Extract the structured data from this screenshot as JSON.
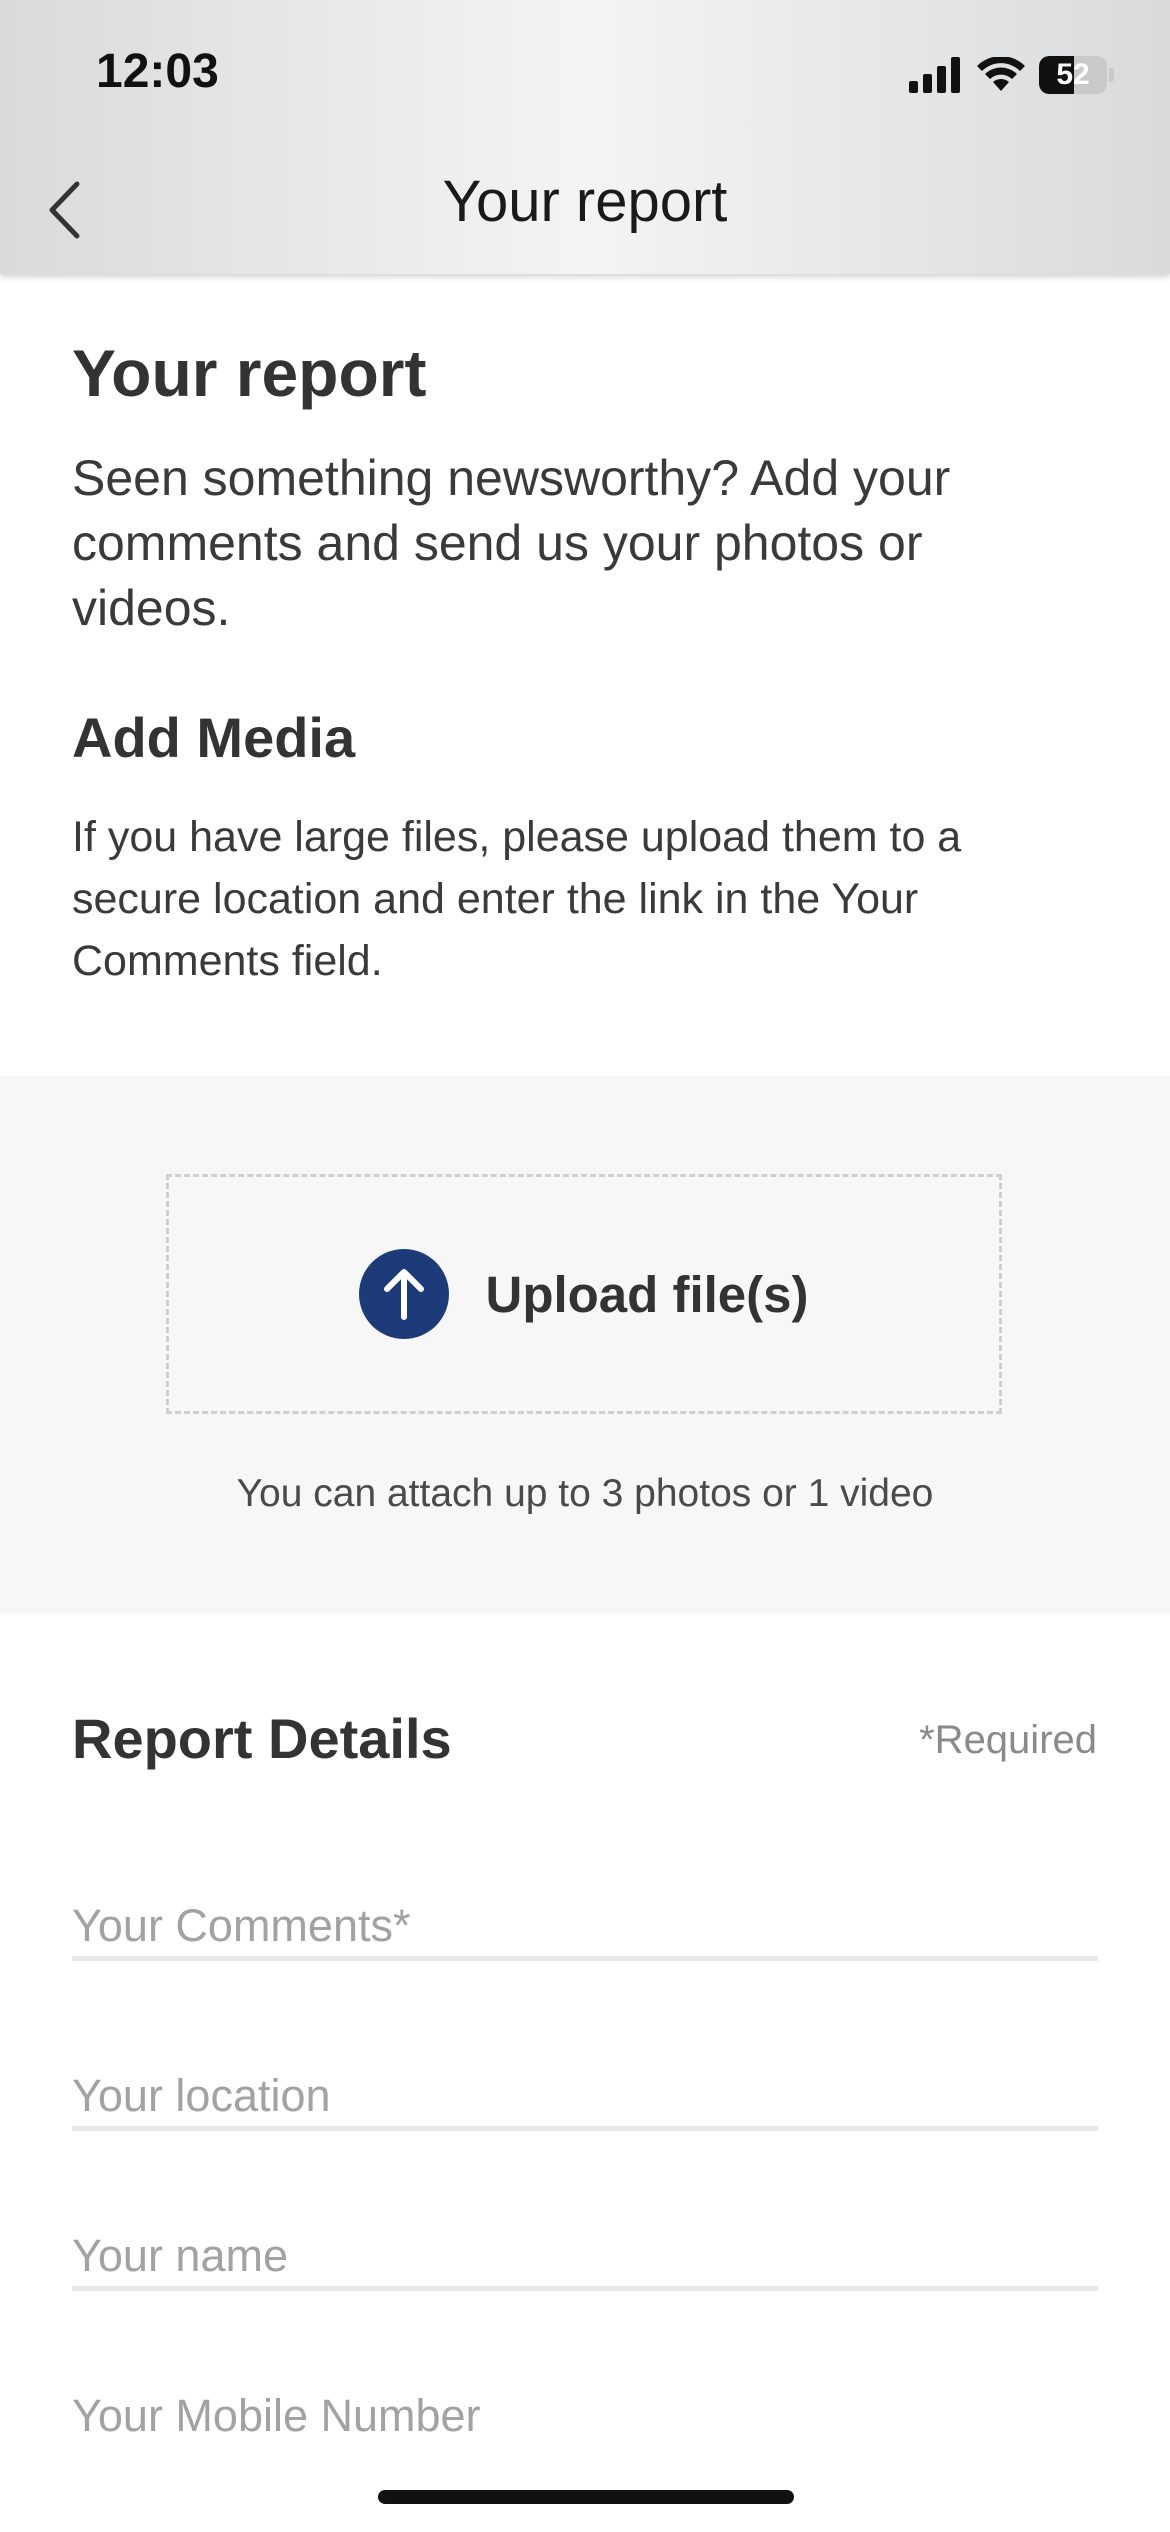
{
  "status_bar": {
    "time": "12:03",
    "battery_level": "52",
    "icons": [
      "cellular-signal-icon",
      "wifi-icon",
      "battery-icon"
    ]
  },
  "nav": {
    "back_icon": "chevron-left-icon",
    "title": "Your report"
  },
  "intro": {
    "heading": "Your report",
    "text": "Seen something newsworthy? Add your comments and send us your photos or videos."
  },
  "media": {
    "heading": "Add Media",
    "note": "If you have large files, please upload them to a secure location and enter the link in the Your Comments field.",
    "upload_label": "Upload file(s)",
    "upload_icon": "upload-arrow-icon",
    "attach_note": "You can attach up to 3 photos or 1 video"
  },
  "report_details": {
    "heading": "Report Details",
    "required_note": "*Required",
    "fields": {
      "comments_placeholder": "Your Comments*",
      "location_placeholder": "Your location",
      "name_placeholder": "Your name",
      "mobile_placeholder": "Your Mobile Number"
    }
  },
  "colors": {
    "accent": "#1c3b78",
    "text": "#333333",
    "placeholder": "#a2a2a2"
  }
}
